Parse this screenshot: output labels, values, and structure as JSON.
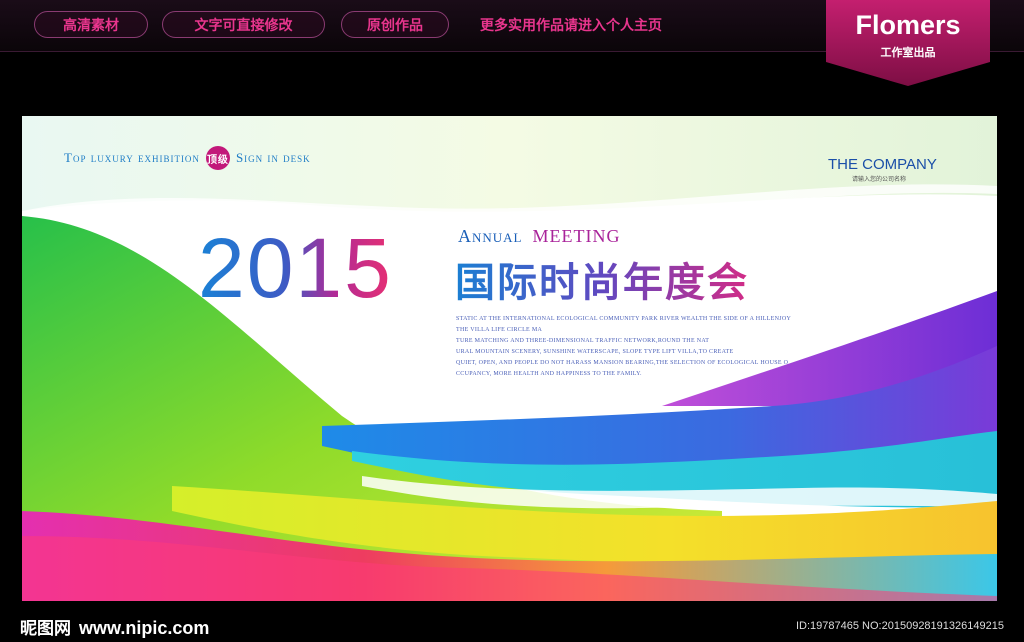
{
  "topbar": {
    "pill_hd": "高清素材",
    "pill_editable": "文字可直接修改",
    "pill_original": "原创作品",
    "more": "更多实用作品请进入个人主页"
  },
  "badge": {
    "title": "Flomers",
    "subtitle": "工作室出品"
  },
  "poster": {
    "tagline_left": "Top luxury exhibition",
    "seal": "顶级",
    "tagline_right": "Sign in desk",
    "company": "THE COMPANY",
    "company_sub": "请输入您的公司名称",
    "year": "2015",
    "annual": "Annual",
    "meeting": "MEETING",
    "title_cn": "国际时尚年度会",
    "blurb": [
      "STATIC AT THE INTERNATIONAL ECOLOGICAL COMMUNITY PARK RIVER WEALTH THE SIDE OF A HILLENJOY",
      "THE VILLA LIFE CIRCLE MA",
      "TURE MATCHING AND THREE-DIMENSIONAL TRAFFIC NETWORK,ROUND THE NAT",
      "URAL MOUNTAIN SCENERY, SUNSHINE WATERSCAPE, SLOPE TYPE LIFT VILLA,TO CREATE",
      "QUIET, OPEN, AND PEOPLE DO NOT HARASS MANSION BEARING,THE SELECTION OF ECOLOGICAL HOUSE O",
      "CCUPANCY, MORE HEALTH AND HAPPINESS TO THE FAMILY."
    ]
  },
  "footer": {
    "site_name": "昵图网",
    "url": "www.nipic.com",
    "id_text": "ID:19787465 NO:20150928191326149215"
  },
  "colors": {
    "accent_pink": "#e8358d",
    "accent_blue": "#1a7fd3",
    "badge": "#b0185f"
  }
}
